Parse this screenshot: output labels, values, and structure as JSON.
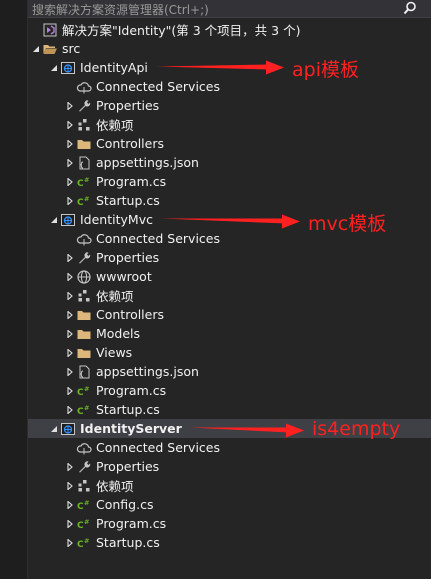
{
  "search": {
    "placeholder": "搜索解决方案资源管理器(Ctrl+;)"
  },
  "solution": {
    "label": "解决方案\"Identity\"(第 3 个项目，共 3 个)"
  },
  "folder": {
    "label": "src"
  },
  "projects": [
    {
      "label": "IdentityApi",
      "bold": false,
      "annotation": "api模板",
      "items": [
        {
          "icon": "connected-services-icon",
          "label": "Connected Services",
          "expander": false
        },
        {
          "icon": "wrench-icon",
          "label": "Properties",
          "expander": true
        },
        {
          "icon": "dependencies-icon",
          "label": "依赖项",
          "expander": true
        },
        {
          "icon": "folder-icon",
          "label": "Controllers",
          "expander": true
        },
        {
          "icon": "json-file-icon",
          "label": "appsettings.json",
          "expander": true
        },
        {
          "icon": "csharp-file-icon",
          "label": "Program.cs",
          "expander": true
        },
        {
          "icon": "csharp-file-icon",
          "label": "Startup.cs",
          "expander": true
        }
      ]
    },
    {
      "label": "IdentityMvc",
      "bold": false,
      "annotation": "mvc模板",
      "items": [
        {
          "icon": "connected-services-icon",
          "label": "Connected Services",
          "expander": false
        },
        {
          "icon": "wrench-icon",
          "label": "Properties",
          "expander": true
        },
        {
          "icon": "globe-icon",
          "label": "wwwroot",
          "expander": true
        },
        {
          "icon": "dependencies-icon",
          "label": "依赖项",
          "expander": true
        },
        {
          "icon": "folder-icon",
          "label": "Controllers",
          "expander": true
        },
        {
          "icon": "folder-icon",
          "label": "Models",
          "expander": true
        },
        {
          "icon": "folder-icon",
          "label": "Views",
          "expander": true
        },
        {
          "icon": "json-file-icon",
          "label": "appsettings.json",
          "expander": true
        },
        {
          "icon": "csharp-file-icon",
          "label": "Program.cs",
          "expander": true
        },
        {
          "icon": "csharp-file-icon",
          "label": "Startup.cs",
          "expander": true
        }
      ]
    },
    {
      "label": "IdentityServer",
      "bold": true,
      "annotation": "is4empty",
      "items": [
        {
          "icon": "connected-services-icon",
          "label": "Connected Services",
          "expander": false
        },
        {
          "icon": "wrench-icon",
          "label": "Properties",
          "expander": true
        },
        {
          "icon": "dependencies-icon",
          "label": "依赖项",
          "expander": true
        },
        {
          "icon": "csharp-file-icon",
          "label": "Config.cs",
          "expander": true
        },
        {
          "icon": "csharp-file-icon",
          "label": "Program.cs",
          "expander": true
        },
        {
          "icon": "csharp-file-icon",
          "label": "Startup.cs",
          "expander": true
        }
      ]
    }
  ],
  "colors": {
    "background": "#252526",
    "text": "#f1f1f1",
    "annotation": "#ff2020",
    "folder": "#dcb67a",
    "csharp": "#68b723",
    "project": "#3794ff"
  }
}
